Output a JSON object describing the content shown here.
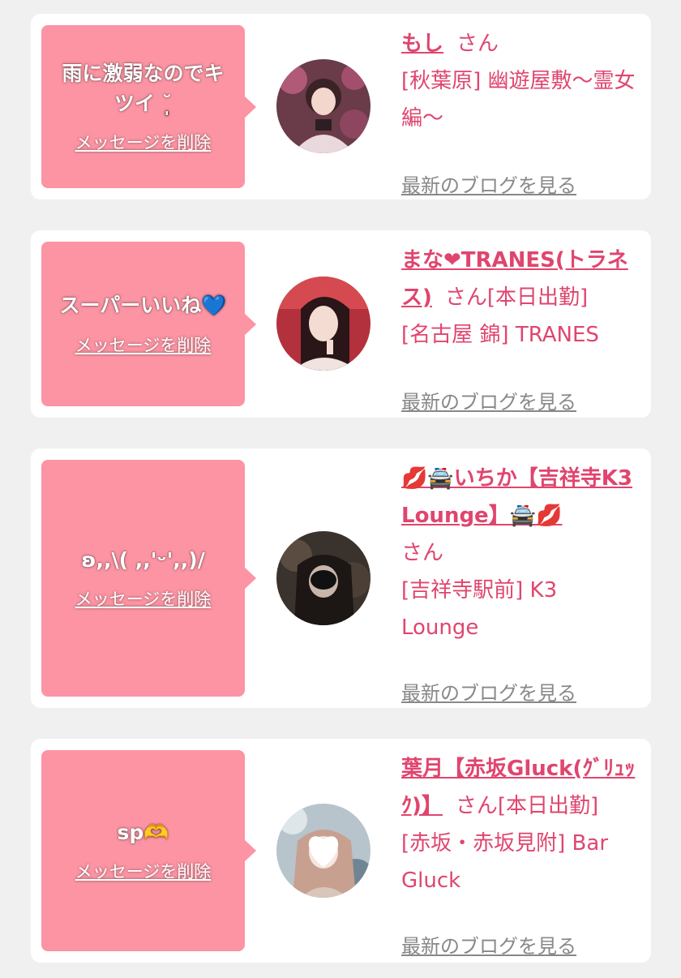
{
  "colors": {
    "accent": "#e0456e",
    "bubble": "#fc94a3",
    "card_bg": "#ffffff",
    "page_bg": "#f0f0f0",
    "link_gray": "#888888"
  },
  "items": [
    {
      "message": "雨に激弱なのでキツイ ˘̩̩̩",
      "delete_label": "メッセージを削除",
      "name": "もし",
      "san": "さん",
      "status": "",
      "shop": "[秋葉原] 幽遊屋敷〜霊女編〜",
      "blog_link": "最新のブログを見る",
      "avatar_icon": "avatar-photo-icon"
    },
    {
      "message": "スーパーいいね💙",
      "delete_label": "メッセージを削除",
      "name": "まな❤TRANES(トラネス)",
      "san": "さん",
      "status": "[本日出勤]",
      "shop": "[名古屋 錦] TRANES",
      "blog_link": "最新のブログを見る",
      "avatar_icon": "avatar-photo-icon"
    },
    {
      "message": "ʚ,,\\( ,,'ᵕ',,)/",
      "delete_label": "メッセージを削除",
      "name": "💋🚔いちか【吉祥寺K3 Lounge】🚔💋",
      "san": "さん",
      "status": "",
      "shop": "[吉祥寺駅前] K3 Lounge",
      "blog_link": "最新のブログを見る",
      "avatar_icon": "avatar-photo-icon"
    },
    {
      "message": "sp🫶",
      "delete_label": "メッセージを削除",
      "name": "葉月【赤坂Gluck(ｸﾞﾘｭｯｸ)】",
      "san": "さん",
      "status": "[本日出勤]",
      "shop": "[赤坂・赤坂見附] Bar Gluck",
      "blog_link": "最新のブログを見る",
      "avatar_icon": "avatar-photo-icon"
    }
  ]
}
